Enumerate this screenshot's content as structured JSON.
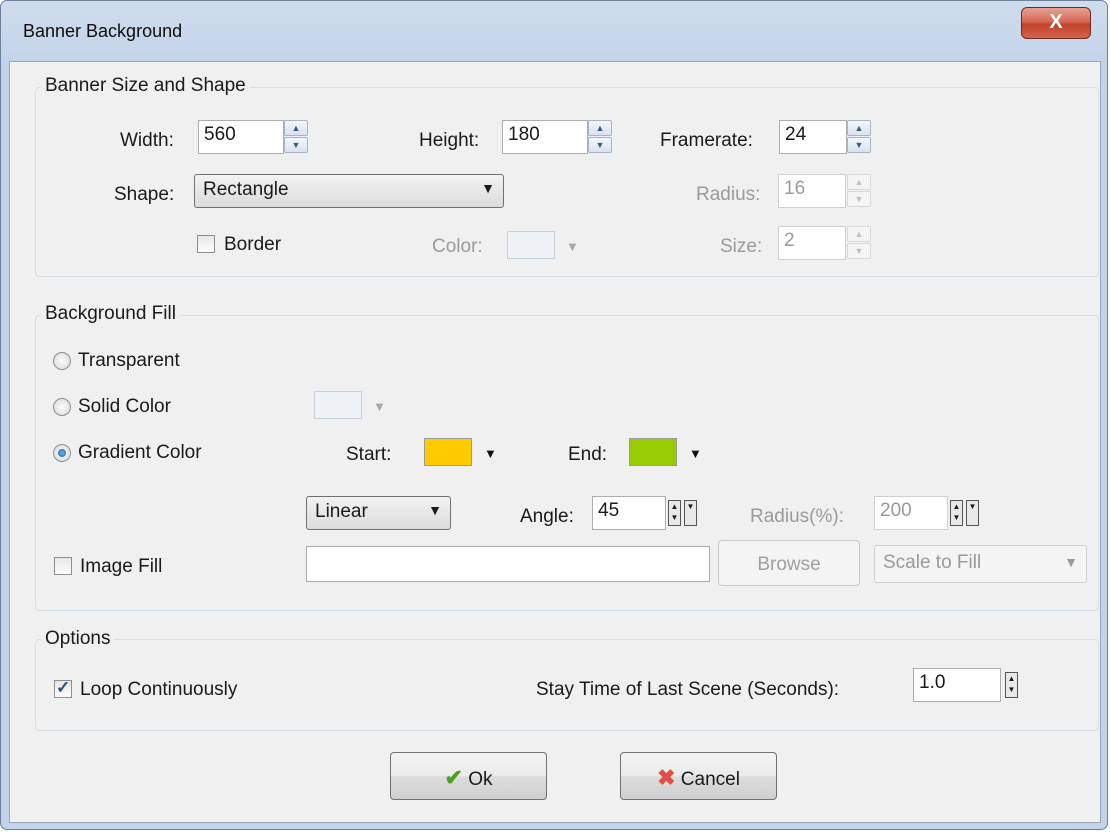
{
  "window": {
    "title": "Banner Background",
    "close_label": "X"
  },
  "size_group": {
    "legend": "Banner Size and Shape",
    "width_label": "Width:",
    "width_value": "560",
    "height_label": "Height:",
    "height_value": "180",
    "framerate_label": "Framerate:",
    "framerate_value": "24",
    "shape_label": "Shape:",
    "shape_value": "Rectangle",
    "radius_label": "Radius:",
    "radius_value": "16",
    "border_label": "Border",
    "color_label": "Color:",
    "size_label": "Size:",
    "size_value": "2"
  },
  "fill_group": {
    "legend": "Background Fill",
    "transparent_label": "Transparent",
    "solid_label": "Solid Color",
    "gradient_label": "Gradient Color",
    "start_label": "Start:",
    "start_color": "#ffcc00",
    "end_label": "End:",
    "end_color": "#99cc00",
    "gradient_type": "Linear",
    "angle_label": "Angle:",
    "angle_value": "45",
    "radius_pct_label": "Radius(%):",
    "radius_pct_value": "200",
    "image_fill_label": "Image Fill",
    "image_path": "",
    "browse_label": "Browse",
    "scale_value": "Scale to Fill"
  },
  "options_group": {
    "legend": "Options",
    "loop_label": "Loop Continuously",
    "stay_label": "Stay Time of Last Scene (Seconds):",
    "stay_value": "1.0"
  },
  "buttons": {
    "ok_label": "Ok",
    "cancel_label": "Cancel"
  }
}
